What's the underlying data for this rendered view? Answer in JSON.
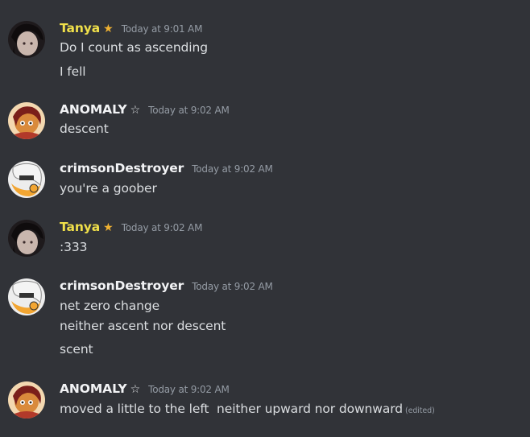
{
  "messages": [
    {
      "author": "Tanya",
      "author_color": "#f0e04a",
      "badge": "★",
      "badge_name": "star-badge-icon",
      "timestamp": "Today at 9:01 AM",
      "avatar": "tanya-avatar",
      "lines": [
        "Do I count as ascending",
        "I fell"
      ]
    },
    {
      "author": "ANOMALY",
      "author_color": "#f2f3f5",
      "badge": "☆",
      "badge_name": "outline-star-badge-icon",
      "timestamp": "Today at 9:02 AM",
      "avatar": "anomaly-avatar",
      "lines": [
        "descent"
      ]
    },
    {
      "author": "crimsonDestroyer",
      "author_color": "#f2f3f5",
      "badge": "",
      "timestamp": "Today at 9:02 AM",
      "avatar": "crimson-avatar",
      "lines": [
        "you're a goober"
      ]
    },
    {
      "author": "Tanya",
      "author_color": "#f0e04a",
      "badge": "★",
      "badge_name": "star-badge-icon",
      "timestamp": "Today at 9:02 AM",
      "avatar": "tanya-avatar",
      "lines": [
        ":333"
      ]
    },
    {
      "author": "crimsonDestroyer",
      "author_color": "#f2f3f5",
      "badge": "",
      "timestamp": "Today at 9:02 AM",
      "avatar": "crimson-avatar",
      "lines": [
        "net zero change",
        "neither ascent nor descent",
        "scent"
      ]
    },
    {
      "author": "ANOMALY",
      "author_color": "#f2f3f5",
      "badge": "☆",
      "badge_name": "outline-star-badge-icon",
      "timestamp": "Today at 9:02 AM",
      "avatar": "anomaly-avatar",
      "lines": [
        "moved a little to the left  neither upward nor downward"
      ],
      "edited_label": "(edited)"
    }
  ],
  "colors": {
    "background": "#313338",
    "text": "#dbdee1",
    "timestamp": "#949ba4",
    "tanya_name": "#f0e04a",
    "badge_star": "#f0b232"
  }
}
